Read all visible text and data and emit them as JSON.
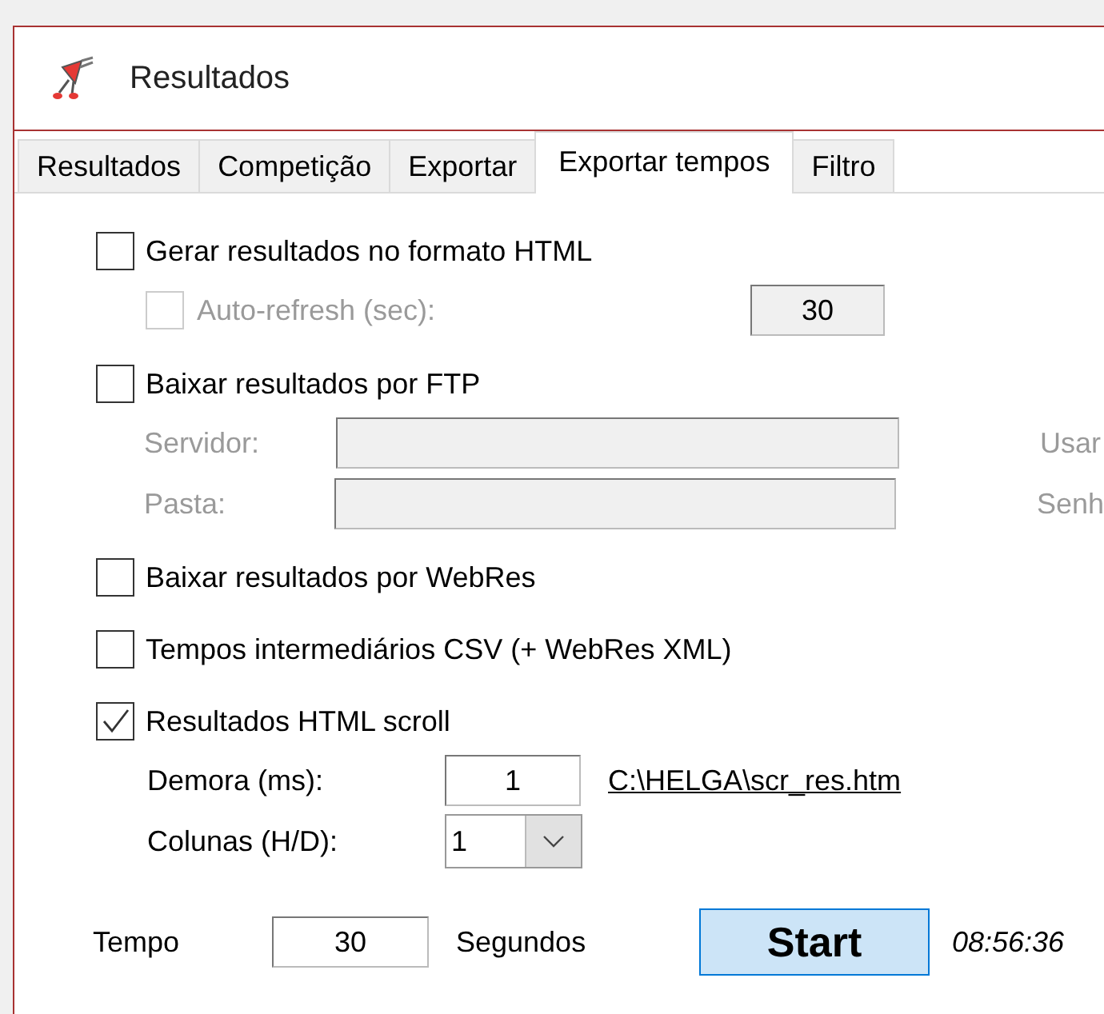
{
  "window": {
    "title": "Resultados"
  },
  "tabs": [
    {
      "label": "Resultados",
      "selected": false
    },
    {
      "label": "Competição",
      "selected": false
    },
    {
      "label": "Exportar",
      "selected": false
    },
    {
      "label": "Exportar tempos",
      "selected": true
    },
    {
      "label": "Filtro",
      "selected": false
    }
  ],
  "options": [
    {
      "kind": "html",
      "label": "Gerar resultados no formato HTML",
      "checked": false,
      "auto_refresh": {
        "label": "Auto-refresh (sec):",
        "checked": false,
        "disabled": true,
        "value": "30"
      }
    },
    {
      "kind": "ftp",
      "label": "Baixar resultados por FTP",
      "checked": false,
      "fields": [
        {
          "label": "Servidor:",
          "disabled": true,
          "side_label": "Usar"
        },
        {
          "label": "Pasta:",
          "disabled": true,
          "side_label": "Senh"
        }
      ]
    },
    {
      "kind": "plain",
      "label": "Baixar resultados por WebRes",
      "checked": false
    },
    {
      "kind": "plain",
      "label": "Tempos intermediários CSV (+ WebRes XML)",
      "checked": false
    },
    {
      "kind": "scroll",
      "label": "Resultados HTML scroll",
      "checked": true,
      "delay": {
        "label": "Demora (ms):",
        "value": "1"
      },
      "file_link": "C:\\HELGA\\scr_res.htm",
      "columns": {
        "label": "Colunas (H/D):",
        "value": "1"
      }
    }
  ],
  "footer": {
    "time_label": "Tempo",
    "time_value": "30",
    "unit": "Segundos",
    "start_button": "Start",
    "clock": "08:56:36"
  }
}
